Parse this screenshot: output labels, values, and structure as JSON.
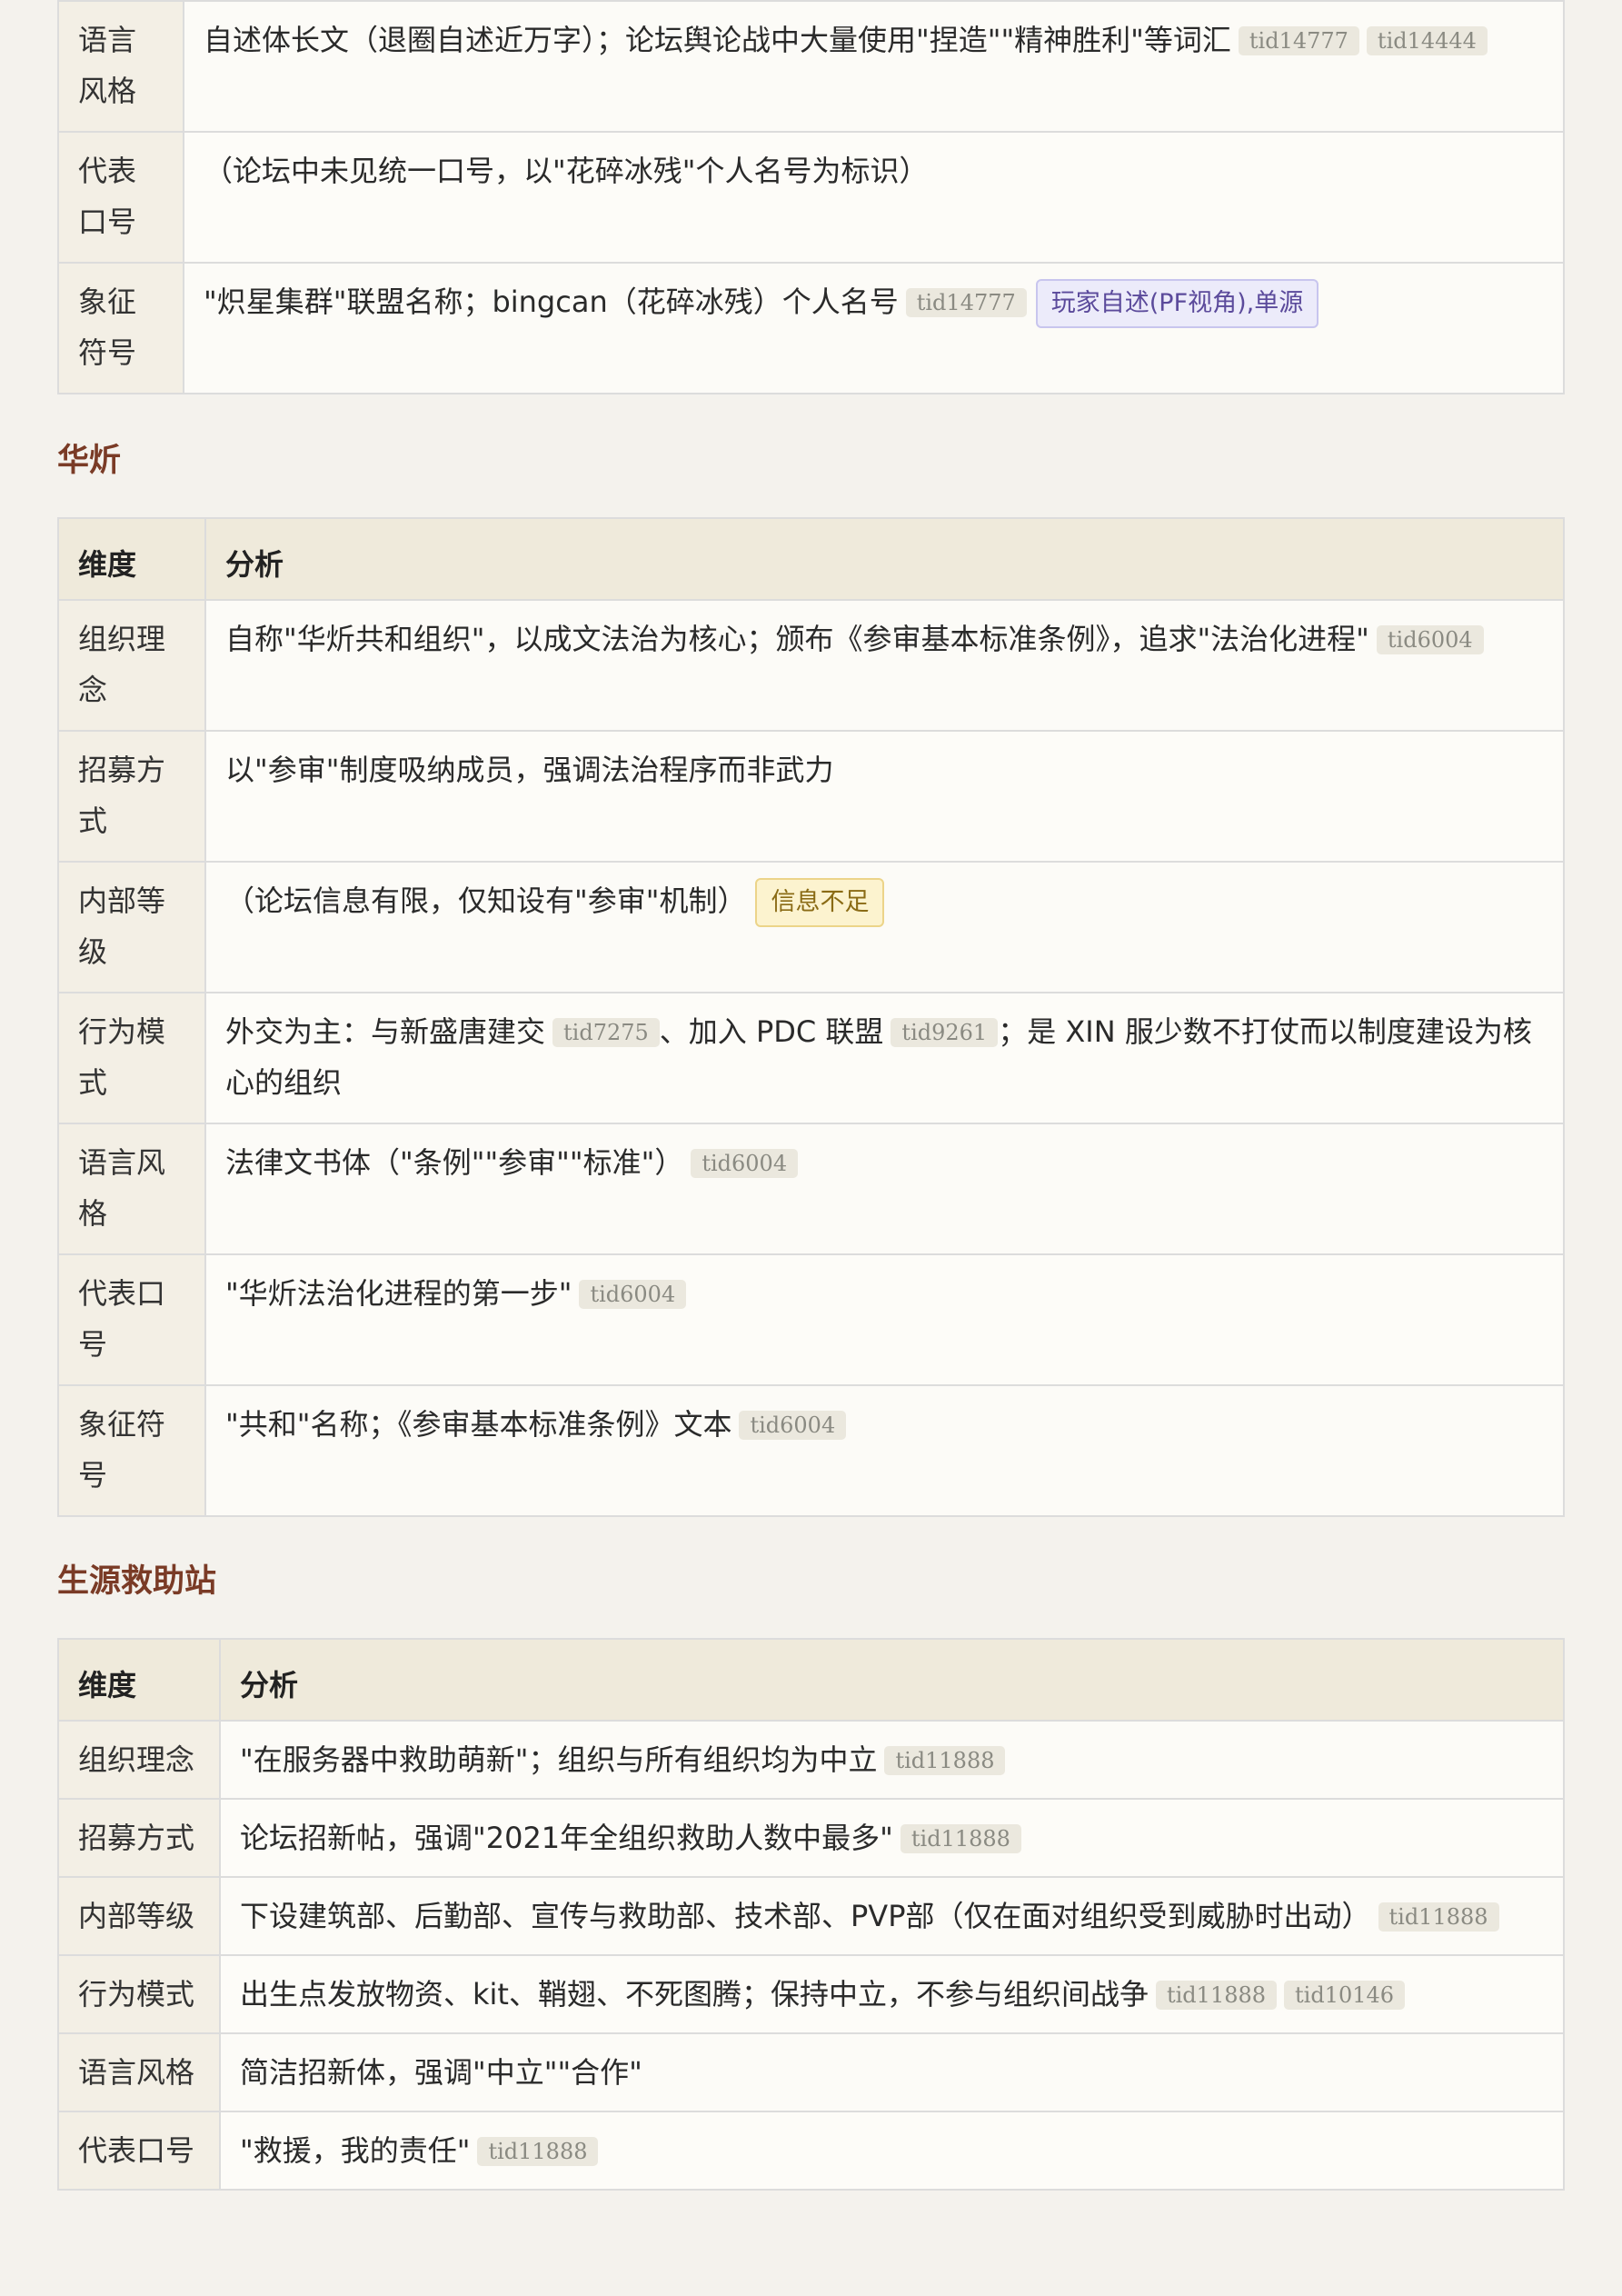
{
  "section0": {
    "rows": [
      {
        "key": "语言风格",
        "text": "自述体长文（退圈自述近万字）；论坛舆论战中大量使用\"捏造\"\"精神胜利\"等词汇",
        "tags": [
          "tid14777",
          "tid14444"
        ]
      },
      {
        "key": "代表口号",
        "text": "（论坛中未见统一口号，以\"花碎冰残\"个人名号为标识）"
      },
      {
        "key": "象征符号",
        "text": "\"炽星集群\"联盟名称；bingcan（花碎冰残）个人名号",
        "tags": [
          "tid14777"
        ],
        "badge": "玩家自述(PF视角),单源"
      }
    ]
  },
  "section1": {
    "title": "华炘",
    "header": {
      "col1": "维度",
      "col2": "分析"
    },
    "rows": [
      {
        "key": "组织理念",
        "text": "自称\"华炘共和组织\"，以成文法治为核心；颁布《参审基本标准条例》，追求\"法治化进程\"",
        "tags": [
          "tid6004"
        ]
      },
      {
        "key": "招募方式",
        "text": "以\"参审\"制度吸纳成员，强调法治程序而非武力"
      },
      {
        "key": "内部等级",
        "text": "（论坛信息有限，仅知设有\"参审\"机制）",
        "badge": "信息不足"
      },
      {
        "key": "行为模式",
        "text_a": "外交为主：与新盛唐建交",
        "tag_a": "tid7275",
        "text_b": "、加入 PDC 联盟",
        "tag_b": "tid9261",
        "text_c": "；是 XIN 服少数不打仗而以制度建设为核心的组织"
      },
      {
        "key": "语言风格",
        "text": "法律文书体（\"条例\"\"参审\"\"标准\"）",
        "tags": [
          "tid6004"
        ]
      },
      {
        "key": "代表口号",
        "text": "\"华炘法治化进程的第一步\"",
        "tags": [
          "tid6004"
        ]
      },
      {
        "key": "象征符号",
        "text": "\"共和\"名称；《参审基本标准条例》文本",
        "tags": [
          "tid6004"
        ]
      }
    ]
  },
  "section2": {
    "title": "生源救助站",
    "header": {
      "col1": "维度",
      "col2": "分析"
    },
    "rows": [
      {
        "key": "组织理念",
        "text": "\"在服务器中救助萌新\"；组织与所有组织均为中立",
        "tags": [
          "tid11888"
        ]
      },
      {
        "key": "招募方式",
        "text": "论坛招新帖，强调\"2021年全组织救助人数中最多\"",
        "tags": [
          "tid11888"
        ]
      },
      {
        "key": "内部等级",
        "text": "下设建筑部、后勤部、宣传与救助部、技术部、PVP部（仅在面对组织受到威胁时出动）",
        "tags": [
          "tid11888"
        ]
      },
      {
        "key": "行为模式",
        "text": "出生点发放物资、kit、鞘翅、不死图腾；保持中立，不参与组织间战争",
        "tags": [
          "tid11888",
          "tid10146"
        ]
      },
      {
        "key": "语言风格",
        "text": "简洁招新体，强调\"中立\"\"合作\""
      },
      {
        "key": "代表口号",
        "text": "\"救援，我的责任\"",
        "tags": [
          "tid11888"
        ]
      }
    ]
  }
}
